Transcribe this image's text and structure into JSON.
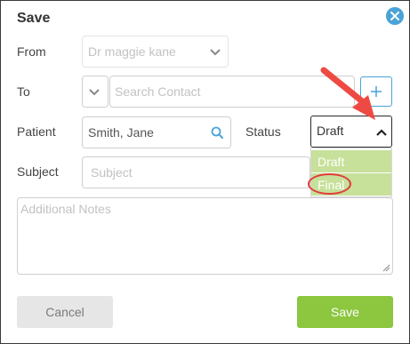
{
  "dialog": {
    "title": "Save"
  },
  "form": {
    "from_label": "From",
    "from_value": "Dr maggie kane",
    "to_label": "To",
    "to_placeholder": "Search Contact",
    "patient_label": "Patient",
    "patient_value": "Smith, Jane",
    "status_label": "Status",
    "status_value": "Draft",
    "status_options": [
      "Draft",
      "Final"
    ],
    "subject_label": "Subject",
    "subject_placeholder": "Subject",
    "notes_placeholder": "Additional Notes"
  },
  "buttons": {
    "cancel": "Cancel",
    "save": "Save"
  },
  "icons": {
    "close": "close-icon",
    "add": "plus-icon",
    "search": "search-icon",
    "chevron_down": "chevron-down-icon",
    "chevron_up": "chevron-up-icon"
  },
  "colors": {
    "accent_blue": "#4aa3d8",
    "save_green": "#8dc63f",
    "dropdown_option_bg": "#c7e09a",
    "annotation_red": "#e23b3b"
  }
}
